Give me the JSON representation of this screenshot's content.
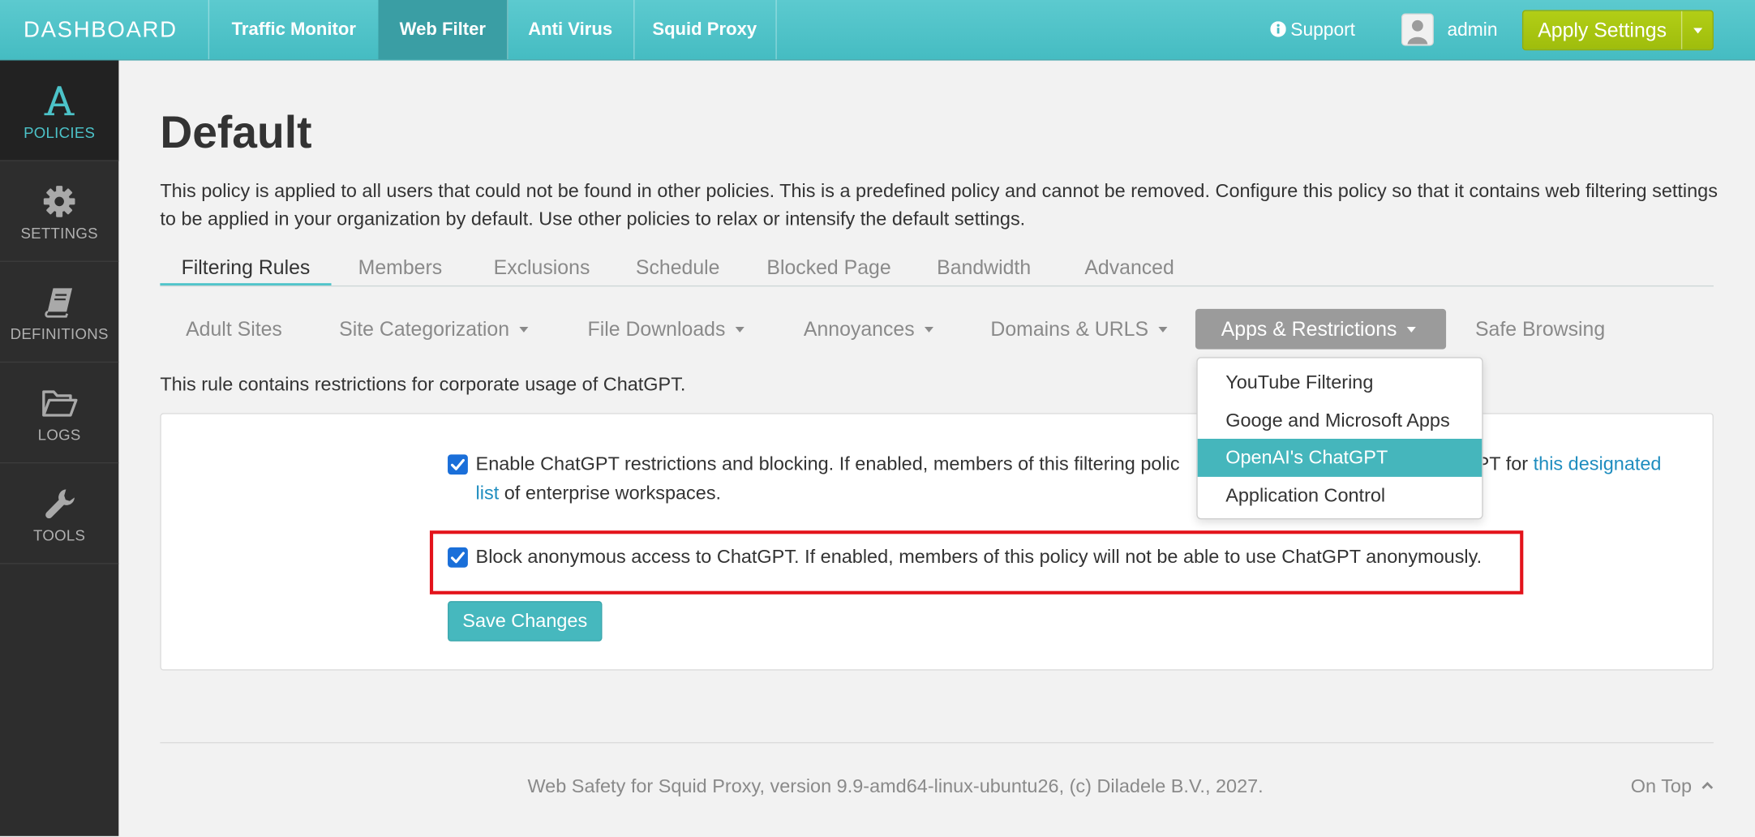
{
  "topnav": {
    "brand": "DASHBOARD",
    "tabs": [
      {
        "label": "Traffic Monitor",
        "active": false
      },
      {
        "label": "Web Filter",
        "active": true
      },
      {
        "label": "Anti Virus",
        "active": false
      },
      {
        "label": "Squid Proxy",
        "active": false
      }
    ],
    "support": {
      "label": "Support",
      "icon": "info-icon"
    },
    "user": {
      "name": "admin",
      "icon": "avatar-icon"
    },
    "apply_button": {
      "label": "Apply Settings",
      "icon": "caret-down-icon"
    }
  },
  "sidebar": {
    "items": [
      {
        "label": "POLICIES",
        "icon": "policies-icon",
        "active": true
      },
      {
        "label": "SETTINGS",
        "icon": "gear-icon",
        "active": false
      },
      {
        "label": "DEFINITIONS",
        "icon": "book-icon",
        "active": false
      },
      {
        "label": "LOGS",
        "icon": "folder-icon",
        "active": false
      },
      {
        "label": "TOOLS",
        "icon": "wrench-icon",
        "active": false
      }
    ]
  },
  "page": {
    "title": "Default",
    "description": "This policy is applied to all users that could not be found in other policies. This is a predefined policy and cannot be removed. Configure this policy so that it contains web filtering settings to be applied in your organization by default. Use other policies to relax or intensify the default settings.",
    "tabs": [
      {
        "label": "Filtering Rules",
        "active": true
      },
      {
        "label": "Members",
        "active": false
      },
      {
        "label": "Exclusions",
        "active": false
      },
      {
        "label": "Schedule",
        "active": false
      },
      {
        "label": "Blocked Page",
        "active": false
      },
      {
        "label": "Bandwidth",
        "active": false
      },
      {
        "label": "Advanced",
        "active": false
      }
    ],
    "subtabs": [
      {
        "label": "Adult Sites",
        "has_menu": false,
        "active": false
      },
      {
        "label": "Site Categorization",
        "has_menu": true,
        "active": false
      },
      {
        "label": "File Downloads",
        "has_menu": true,
        "active": false
      },
      {
        "label": "Annoyances",
        "has_menu": true,
        "active": false
      },
      {
        "label": "Domains & URLS",
        "has_menu": true,
        "active": false
      },
      {
        "label": "Apps & Restrictions",
        "has_menu": true,
        "active": true
      },
      {
        "label": "Safe Browsing",
        "has_menu": false,
        "active": false
      }
    ],
    "apps_menu": {
      "open": true,
      "items": [
        {
          "label": "YouTube Filtering",
          "highlighted": false
        },
        {
          "label": "Googe and Microsoft Apps",
          "highlighted": false
        },
        {
          "label": "OpenAI's ChatGPT",
          "highlighted": true
        },
        {
          "label": "Application Control",
          "highlighted": false
        }
      ]
    },
    "rule_note": "This rule contains restrictions for corporate usage of ChatGPT.",
    "options": [
      {
        "checked": true,
        "text_part1": "Enable ChatGPT restrictions and blocking. If enabled, members of this filtering polic",
        "text_part2": "GPT for ",
        "link": "this designated list",
        "text_part3": " of enterprise workspaces."
      },
      {
        "checked": true,
        "highlighted": true,
        "text": "Block anonymous access to ChatGPT. If enabled, members of this policy will not be able to use ChatGPT anonymously."
      }
    ],
    "save_button": "Save Changes"
  },
  "footer": {
    "text": "Web Safety for Squid Proxy, version 9.9-amd64-linux-ubuntu26, (c) Diladele B.V., 2027.",
    "on_top": "On Top"
  },
  "colors": {
    "accent": "#4cc3c9",
    "topbar": "#45bcc2",
    "nav_active": "#3a9ea4",
    "apply": "#9fbd0c",
    "sidebar_bg": "#2d2d2d",
    "dropdown_active": "#45b6bc",
    "checkbox": "#1a6fd9",
    "link": "#1f8dbf",
    "highlight_border": "#e3131b",
    "accent_button": "#46b8be"
  }
}
